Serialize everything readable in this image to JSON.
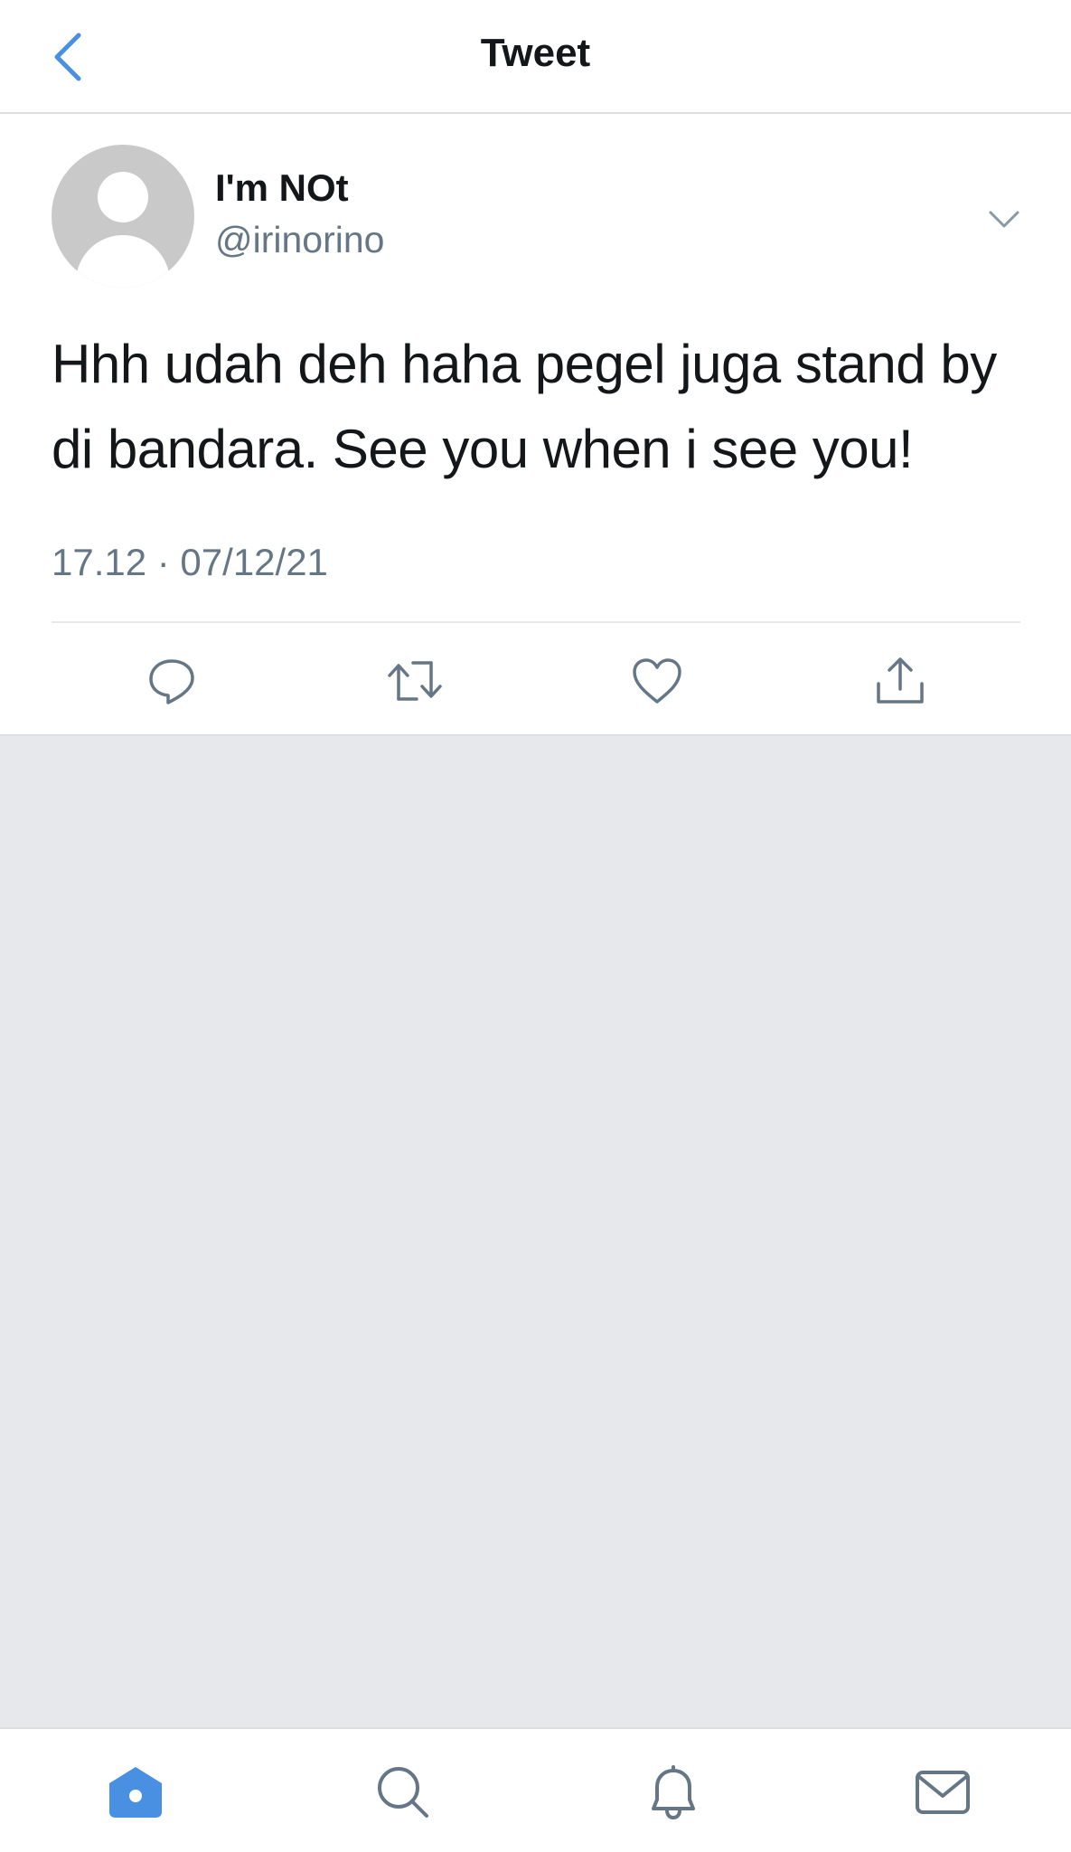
{
  "header": {
    "title": "Tweet",
    "back_icon": "chevron-left-icon"
  },
  "tweet": {
    "author": {
      "display_name": "I'm NOt",
      "handle": "@irinorino",
      "avatar": "default-avatar-icon"
    },
    "text": "Hhh udah deh haha pegel juga stand by di bandara. See you when i see you!",
    "timestamp": "17.12 · 07/12/21",
    "menu_icon": "chevron-down-icon",
    "actions": [
      "reply-icon",
      "retweet-icon",
      "like-icon",
      "share-icon"
    ]
  },
  "bottom_nav": {
    "items": [
      "home-icon",
      "search-icon",
      "notifications-icon",
      "messages-icon"
    ],
    "active": "home-icon"
  },
  "colors": {
    "accent": "#4a90e2",
    "text_primary": "#14171a",
    "text_secondary": "#657786",
    "background": "#e7e8ec",
    "icon_gray": "#657786"
  }
}
